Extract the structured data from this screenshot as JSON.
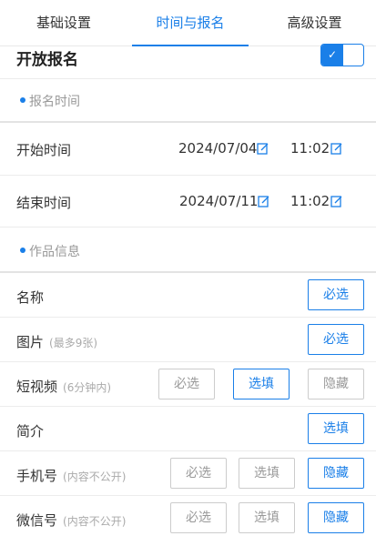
{
  "tabs": [
    {
      "label": "基础设置"
    },
    {
      "label": "时间与报名"
    },
    {
      "label": "高级设置"
    }
  ],
  "open_signup": {
    "title": "开放报名",
    "toggle_check": "✓",
    "enabled": true
  },
  "signup_time": {
    "section": "报名时间",
    "start": {
      "label": "开始时间",
      "date": "2024/07/04",
      "time": "11:02"
    },
    "end": {
      "label": "结束时间",
      "date": "2024/07/11",
      "time": "11:02"
    }
  },
  "work_info": {
    "section": "作品信息",
    "rows": [
      {
        "label": "名称",
        "sub": "",
        "buttons": [
          "必选"
        ]
      },
      {
        "label": "图片",
        "sub": "(最多9张)",
        "buttons": [
          "必选"
        ]
      },
      {
        "label": "短视频",
        "sub": "(6分钟内)",
        "buttons": [
          "必选",
          "选填",
          "隐藏"
        ]
      },
      {
        "label": "简介",
        "sub": "",
        "buttons": [
          "选填"
        ]
      },
      {
        "label": "手机号",
        "sub": "(内容不公开)",
        "buttons": [
          "必选",
          "选填",
          "隐藏"
        ]
      },
      {
        "label": "微信号",
        "sub": "(内容不公开)",
        "buttons": [
          "必选",
          "选填",
          "隐藏"
        ]
      }
    ]
  },
  "colors": {
    "accent": "#1a7fe8",
    "muted": "#999999",
    "border": "#cccccc"
  },
  "icons": {
    "edit": "edit-icon",
    "check": "check-icon"
  }
}
